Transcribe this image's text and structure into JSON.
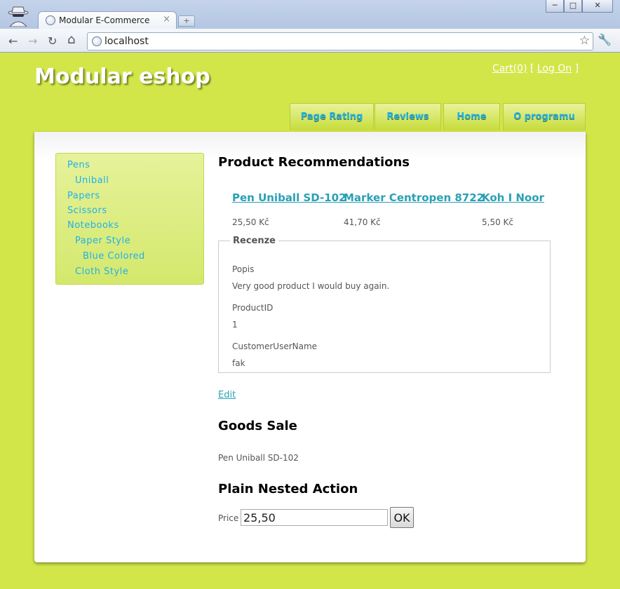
{
  "browser": {
    "tab_title": "Modular E-Commerce",
    "tab_close": "×",
    "new_tab": "+",
    "url": "localhost",
    "win_min": "─",
    "win_max": "□",
    "win_close": "✕",
    "back": "←",
    "forward": "→",
    "reload": "↻",
    "home": "⌂",
    "star": "☆",
    "wrench": "🔧"
  },
  "header": {
    "title": "Modular eshop",
    "cart": "Cart(0)",
    "login_open": "[",
    "login": "Log On",
    "login_close": "]"
  },
  "menu": [
    "Page Rating",
    "Reviews",
    "Home",
    "O programu"
  ],
  "sidebar": {
    "items": [
      {
        "label": "Pens",
        "level": 0
      },
      {
        "label": "Uniball",
        "level": 1
      },
      {
        "label": "Papers",
        "level": 0
      },
      {
        "label": "Scissors",
        "level": 0
      },
      {
        "label": "Notebooks",
        "level": 0
      },
      {
        "label": "Paper Style",
        "level": 1
      },
      {
        "label": "Blue Colored",
        "level": 2
      },
      {
        "label": "Cloth Style",
        "level": 1
      }
    ]
  },
  "recommendations": {
    "heading": "Product Recommendations",
    "products": [
      {
        "name": "Pen Uniball SD-102",
        "price": "25,50 Kč"
      },
      {
        "name": "Marker Centropen 8722",
        "price": "41,70 Kč"
      },
      {
        "name": "Koh I Noor",
        "price": "5,50 Kč"
      }
    ]
  },
  "review": {
    "legend": "Recenze",
    "fields": [
      {
        "label": "Popis",
        "value": "Very good product I would buy again."
      },
      {
        "label": "ProductID",
        "value": "1"
      },
      {
        "label": "CustomerUserName",
        "value": "fak"
      }
    ],
    "edit": "Edit"
  },
  "sale": {
    "heading": "Goods Sale",
    "item": "Pen Uniball SD-102"
  },
  "nested": {
    "heading": "Plain Nested Action",
    "price_label": "Price",
    "price_value": "25,50",
    "ok": "OK"
  }
}
